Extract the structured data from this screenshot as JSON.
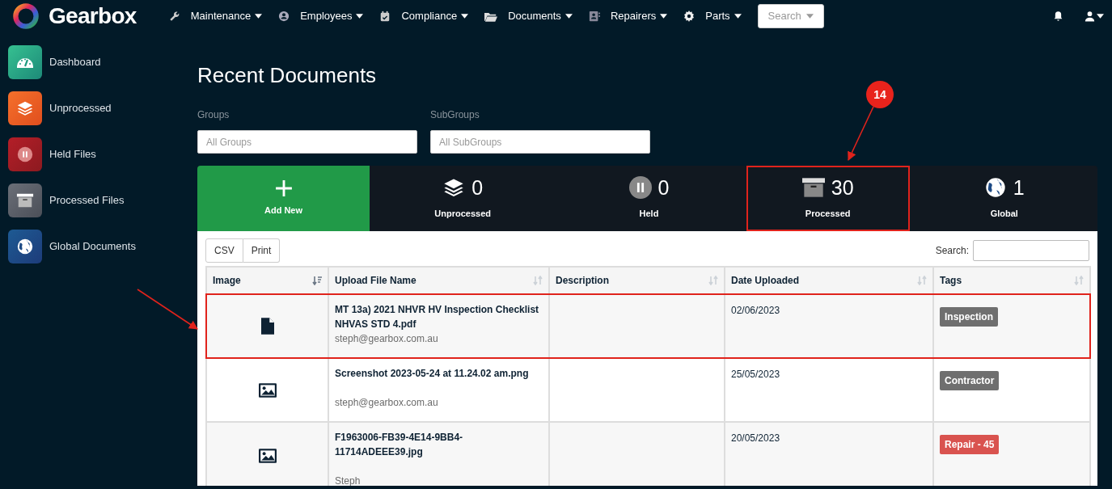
{
  "brand": "Gearbox",
  "nav": [
    {
      "label": "Maintenance"
    },
    {
      "label": "Employees"
    },
    {
      "label": "Compliance"
    },
    {
      "label": "Documents"
    },
    {
      "label": "Repairers"
    },
    {
      "label": "Parts"
    }
  ],
  "search_button": "Search",
  "sidebar": {
    "items": [
      {
        "label": "Dashboard"
      },
      {
        "label": "Unprocessed"
      },
      {
        "label": "Held Files"
      },
      {
        "label": "Processed Files"
      },
      {
        "label": "Global Documents"
      }
    ]
  },
  "page_title": "Recent Documents",
  "filters": [
    {
      "label": "Groups",
      "placeholder": "All Groups"
    },
    {
      "label": "SubGroups",
      "placeholder": "All SubGroups"
    }
  ],
  "stats": [
    {
      "kind": "add",
      "label": "Add New",
      "highlighted": false
    },
    {
      "kind": "count",
      "count": "0",
      "label": "Unprocessed",
      "highlighted": false
    },
    {
      "kind": "count",
      "count": "0",
      "label": "Held",
      "highlighted": false
    },
    {
      "kind": "count",
      "count": "30",
      "label": "Processed",
      "highlighted": true
    },
    {
      "kind": "count",
      "count": "1",
      "label": "Global",
      "highlighted": false
    }
  ],
  "export_buttons": [
    "CSV",
    "Print"
  ],
  "table_search_label": "Search:",
  "table": {
    "columns": [
      {
        "label": "Image",
        "sorted": true
      },
      {
        "label": "Upload File Name",
        "sorted": false
      },
      {
        "label": "Description",
        "sorted": false
      },
      {
        "label": "Date Uploaded",
        "sorted": false
      },
      {
        "label": "Tags",
        "sorted": false
      }
    ],
    "rows": [
      {
        "kind": "file",
        "file_name": "MT 13a) 2021 NHVR HV Inspection Checklist NHVAS STD 4.pdf",
        "uploader": "steph@gearbox.com.au",
        "date": "02/06/2023",
        "tag": {
          "label": "Inspection",
          "color": "#6f6f6f"
        },
        "highlighted": true
      },
      {
        "kind": "image",
        "file_name": "Screenshot 2023-05-24 at 11.24.02 am.png",
        "uploader": "steph@gearbox.com.au",
        "date": "25/05/2023",
        "tag": {
          "label": "Contractor",
          "color": "#6f6f6f"
        },
        "highlighted": false
      },
      {
        "kind": "image",
        "file_name": "F1963006-FB39-4E14-9BB4-11714ADEEE39.jpg",
        "uploader": "Steph",
        "date": "20/05/2023",
        "tag": {
          "label": "Repair - 45",
          "color": "#d9534f"
        },
        "highlighted": false
      }
    ]
  },
  "annotation": {
    "callout": "14"
  }
}
